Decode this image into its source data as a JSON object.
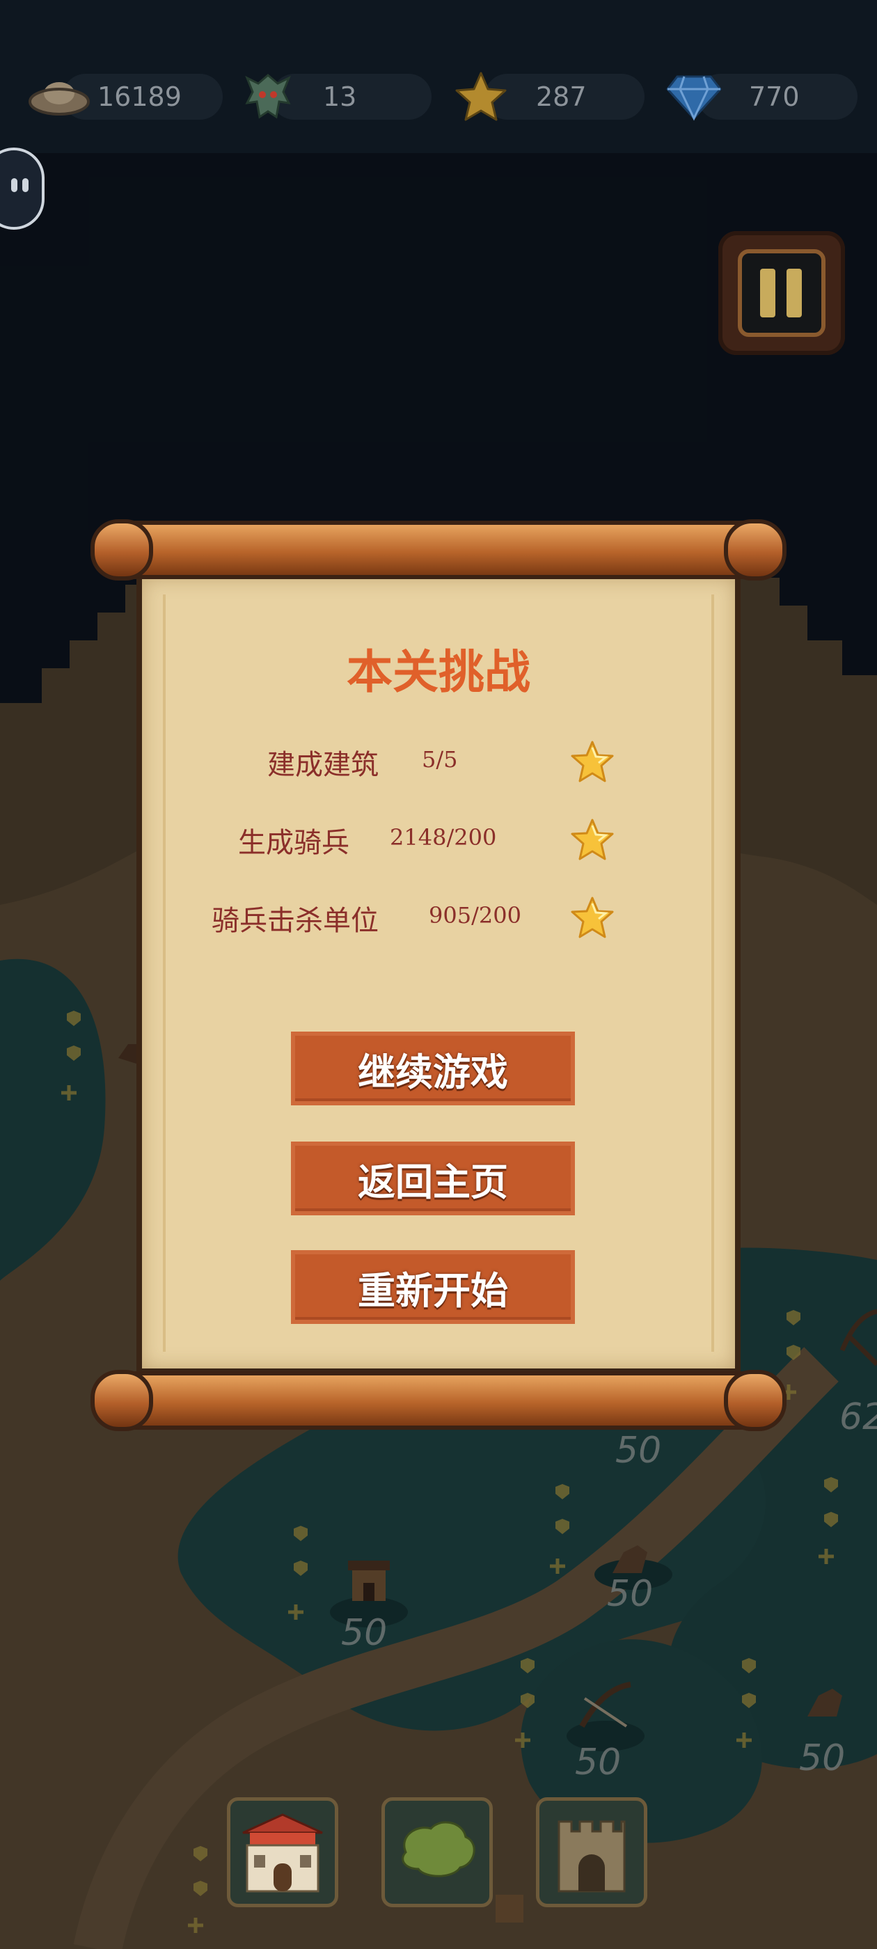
{
  "resources": [
    {
      "icon": "gold-ingot-icon",
      "value": "16189"
    },
    {
      "icon": "dragon-helmet-icon",
      "value": "13"
    },
    {
      "icon": "star-icon",
      "value": "287"
    },
    {
      "icon": "diamond-icon",
      "value": "770"
    }
  ],
  "dialog": {
    "title": "本关挑战",
    "challenges": [
      {
        "label": "建成建筑",
        "progress": "5/5",
        "icon": "star-icon"
      },
      {
        "label": "生成骑兵",
        "progress": "2148/200",
        "icon": "star-icon"
      },
      {
        "label": "骑兵击杀单位",
        "progress": "905/200",
        "icon": "star-icon"
      }
    ],
    "buttons": {
      "continue": "继续游戏",
      "home": "返回主页",
      "restart": "重新开始"
    }
  },
  "map": {
    "unit_costs": [
      "50",
      "50",
      "50",
      "50",
      "50",
      "62",
      "50",
      "50",
      "50"
    ]
  },
  "bottom_bar": {
    "slots": [
      {
        "icon": "palace-gate-icon"
      },
      {
        "icon": "tree-icon"
      },
      {
        "icon": "castle-tower-icon"
      }
    ]
  },
  "colors": {
    "title": "#e0602a",
    "challenge_text": "#8b2f2a",
    "button_fill": "#c45a2a",
    "parchment": "#e8d2a2",
    "rod": "#b8642a"
  }
}
